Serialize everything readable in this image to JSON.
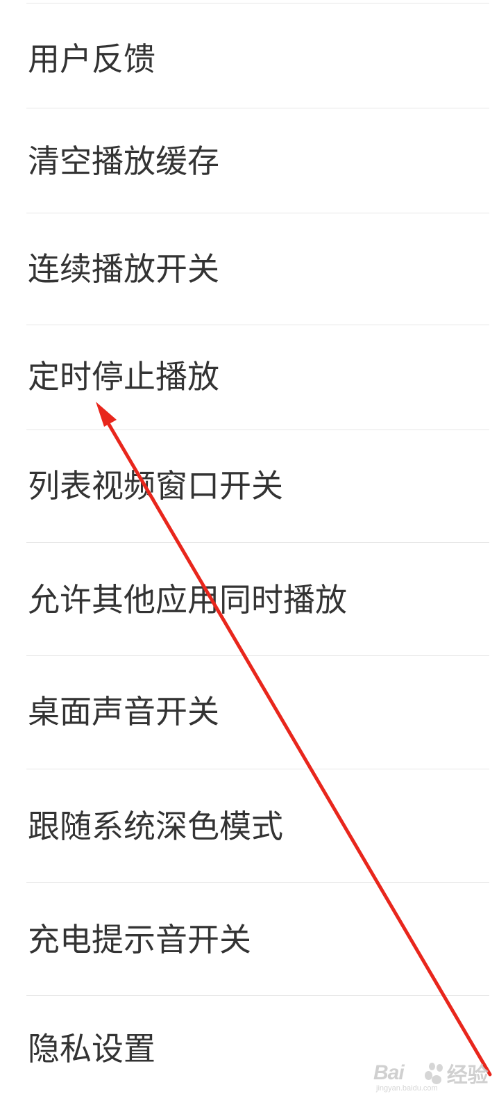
{
  "settings": {
    "items": [
      {
        "label": "用户反馈"
      },
      {
        "label": "清空播放缓存"
      },
      {
        "label": "连续播放开关"
      },
      {
        "label": "定时停止播放"
      },
      {
        "label": "列表视频窗口开关"
      },
      {
        "label": "允许其他应用同时播放"
      },
      {
        "label": "桌面声音开关"
      },
      {
        "label": "跟随系统深色模式"
      },
      {
        "label": "充电提示音开关"
      },
      {
        "label": "隐私设置"
      }
    ]
  },
  "annotation": {
    "arrow_color": "#e8261c",
    "points_to": "定时停止播放"
  },
  "watermark": {
    "brand_a": "Bai",
    "brand_b": "经验",
    "sub": "jingyan.baidu.com"
  },
  "colors": {
    "background": "#ffffff",
    "text": "#333333",
    "divider": "#e6e6e6"
  }
}
